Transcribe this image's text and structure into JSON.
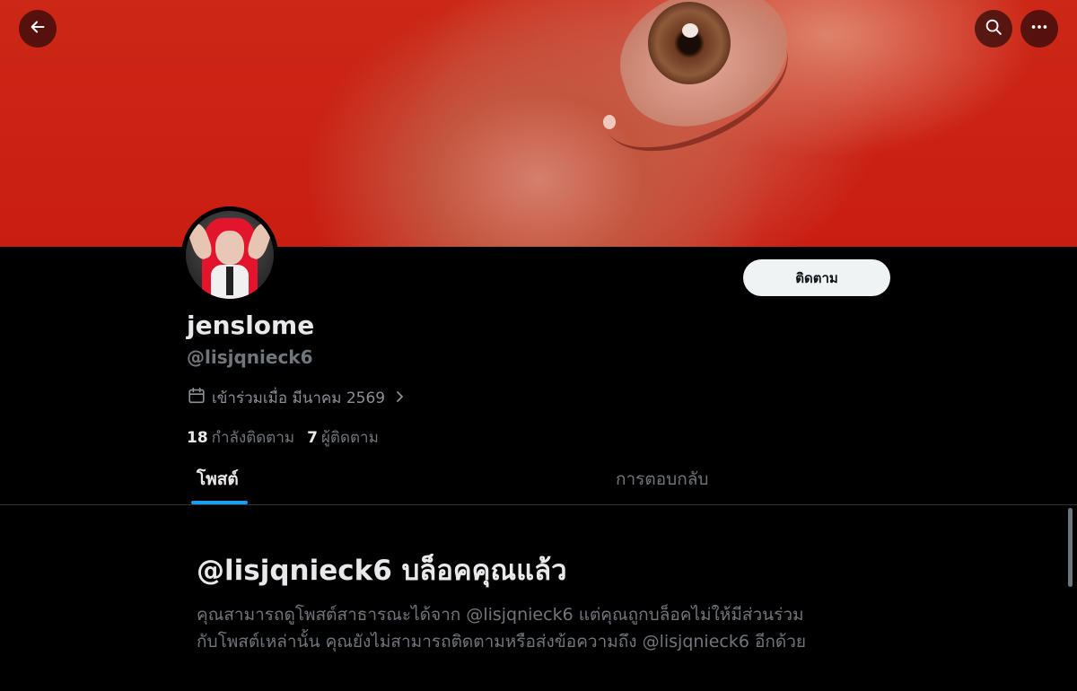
{
  "header": {
    "back_icon": "arrow-left-icon",
    "search_icon": "search-icon",
    "more_icon": "more-horizontal-icon"
  },
  "profile": {
    "display_name": "jenslome",
    "handle": "@lisjqnieck6",
    "joined": "เข้าร่วมเมื่อ มีนาคม 2569",
    "follow_label": "ติดตาม",
    "following_count": "18",
    "following_label": "กำลังติดตาม",
    "followers_count": "7",
    "followers_label": "ผู้ติดตาม"
  },
  "tabs": [
    {
      "label": "โพสต์",
      "active": true
    },
    {
      "label": "การตอบกลับ",
      "active": false
    }
  ],
  "blocked": {
    "title": "@lisjqnieck6 บล็อคคุณแล้ว",
    "line1": "คุณสามารถดูโพสต์สาธารณะได้จาก @lisjqnieck6 แต่คุณถูกบล็อคไม่ให้มีส่วนร่วม",
    "line2": "กับโพสต์เหล่านั้น คุณยังไม่สามารถติดตามหรือส่งข้อความถึง @lisjqnieck6 อีกด้วย"
  },
  "colors": {
    "accent": "#1d9bf0",
    "banner_red": "#c91d12",
    "background": "#000000",
    "muted_text": "#71767b"
  }
}
